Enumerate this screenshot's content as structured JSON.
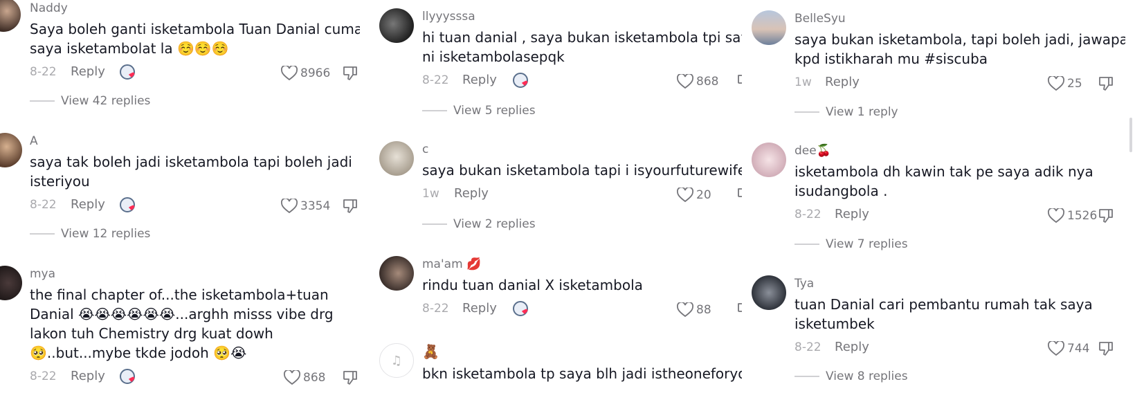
{
  "colors": {
    "accent": "#fe2c55",
    "text": "#161823",
    "secondary": "#75757a"
  },
  "columns": [
    [
      {
        "username": "Naddy",
        "text": [
          "Saya boleh ganti isketambola Tuan Danial cuma",
          "saya isketambolat la ☺️☺️☺️"
        ],
        "date": "8-22",
        "reply": "Reply",
        "creator_liked": true,
        "likes": "8966",
        "view_replies": "View 42 replies"
      },
      {
        "username": "A",
        "text": [
          "saya tak boleh jadi isketambola tapi boleh jadi",
          "isteriyou"
        ],
        "date": "8-22",
        "reply": "Reply",
        "creator_liked": true,
        "likes": "3354",
        "view_replies": "View 12 replies"
      },
      {
        "username": "mya",
        "text": [
          "the final chapter of...the isketambola+tuan",
          "Danial 😭😭😭😭😭😭...arghh misss vibe drg",
          "lakon tuh Chemistry drg kuat dowh",
          "🥺..but...mybe tkde jodoh 🥺😭"
        ],
        "date": "8-22",
        "reply": "Reply",
        "creator_liked": true,
        "likes": "868",
        "view_replies": ""
      }
    ],
    [
      {
        "username": "llyyysssa",
        "text": [
          "hi tuan danial , saya bukan isketambola tpi saya",
          "ni isketambolasepqk"
        ],
        "date": "8-22",
        "reply": "Reply",
        "creator_liked": true,
        "likes": "868",
        "view_replies": "View 5 replies"
      },
      {
        "username": "c",
        "text": [
          "saya bukan isketambola tapi i isyourfuturewife"
        ],
        "date": "1w",
        "reply": "Reply",
        "creator_liked": false,
        "likes": "20",
        "view_replies": "View 2 replies"
      },
      {
        "username": "ma'am 💋",
        "text": [
          "rindu tuan danial X isketambola"
        ],
        "date": "8-22",
        "reply": "Reply",
        "creator_liked": true,
        "likes": "88",
        "view_replies": ""
      },
      {
        "username": "🧸",
        "text": [
          "bkn isketambola tp saya blh jadi istheoneforyou"
        ],
        "date": "",
        "reply": "",
        "creator_liked": false,
        "likes": "",
        "view_replies": ""
      }
    ],
    [
      {
        "username": "BelleSyu",
        "text": [
          "saya bukan isketambola, tapi boleh jadi, jawapan",
          "kpd istikharah mu #siscuba"
        ],
        "date": "1w",
        "reply": "Reply",
        "creator_liked": false,
        "likes": "25",
        "view_replies": "View 1 reply"
      },
      {
        "username": "dee🍒",
        "text": [
          "isketambola dh kawin tak pe saya adik nya",
          "isudangbola ."
        ],
        "date": "8-22",
        "reply": "Reply",
        "creator_liked": false,
        "likes": "1526",
        "view_replies": "View 7 replies"
      },
      {
        "username": "Tya",
        "text": [
          "tuan Danial cari pembantu rumah tak saya",
          "isketumbek"
        ],
        "date": "8-22",
        "reply": "Reply",
        "creator_liked": false,
        "likes": "744",
        "view_replies": "View 8 replies"
      }
    ]
  ]
}
